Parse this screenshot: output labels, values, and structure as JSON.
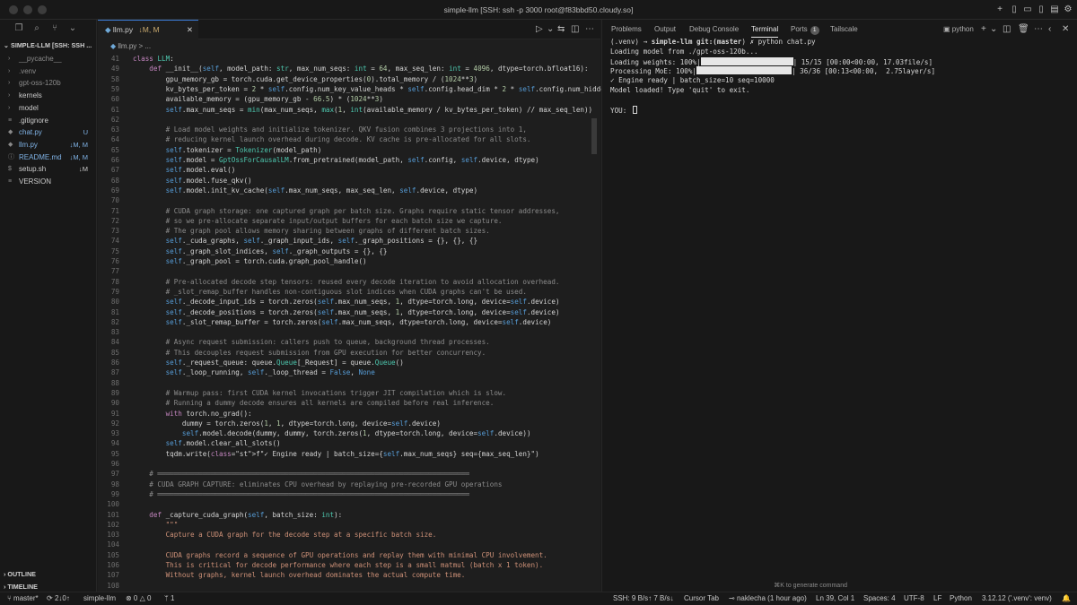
{
  "window": {
    "title": "simple-llm [SSH: ssh -p 3000 root@f83bbd50.cloudy.so]"
  },
  "explorer": {
    "root": "SIMPLE-LLM [SSH: SSH ...",
    "items": [
      {
        "name": "__pycache__",
        "kind": "folder",
        "badge": "",
        "color": "#8a8a8a"
      },
      {
        "name": ".venv",
        "kind": "folder",
        "badge": "",
        "color": "#8a8a8a"
      },
      {
        "name": "gpt-oss-120b",
        "kind": "folder",
        "badge": "",
        "color": "#8a8a8a"
      },
      {
        "name": "kernels",
        "kind": "folder",
        "badge": "",
        "color": "#cccccc"
      },
      {
        "name": "model",
        "kind": "folder",
        "badge": "",
        "color": "#cccccc"
      },
      {
        "name": ".gitignore",
        "kind": "file",
        "badge": "",
        "color": "#cccccc"
      },
      {
        "name": "chat.py",
        "kind": "file",
        "badge": "U",
        "color": "#7fb2e5"
      },
      {
        "name": "llm.py",
        "kind": "file",
        "badge": "↓M, M",
        "color": "#7fb2e5"
      },
      {
        "name": "README.md",
        "kind": "file",
        "badge": "↓M, M",
        "color": "#7fb2e5"
      },
      {
        "name": "setup.sh",
        "kind": "file",
        "badge": "↓M",
        "color": "#cccccc"
      },
      {
        "name": "VERSION",
        "kind": "file",
        "badge": "",
        "color": "#cccccc"
      }
    ],
    "outline": "OUTLINE",
    "timeline": "TIMELINE"
  },
  "editor": {
    "tab_label": "llm.py",
    "tab_status": "↓M, M",
    "close_glyph": "✕",
    "breadcrumb_file": "llm.py",
    "breadcrumb_sep": " > ...",
    "lines": [
      {
        "n": "41",
        "t": "class LLM:"
      },
      {
        "n": "49",
        "t": "    def __init__(self, model_path: str, max_num_seqs: int = 64, max_seq_len: int = 4096, dtype=torch.bfloat16):"
      },
      {
        "n": "58",
        "t": "        gpu_memory_gb = torch.cuda.get_device_properties(0).total_memory / (1024**3)"
      },
      {
        "n": "59",
        "t": "        kv_bytes_per_token = 2 * self.config.num_key_value_heads * self.config.head_dim * 2 * self.config.num_hidde"
      },
      {
        "n": "60",
        "t": "        available_memory = (gpu_memory_gb - 66.5) * (1024**3)"
      },
      {
        "n": "61",
        "t": "        self.max_num_seqs = min(max_num_seqs, max(1, int(available_memory / kv_bytes_per_token) // max_seq_len))"
      },
      {
        "n": "62",
        "t": ""
      },
      {
        "n": "63",
        "t": "        # Load model weights and initialize tokenizer. QKV fusion combines 3 projections into 1,"
      },
      {
        "n": "64",
        "t": "        # reducing kernel launch overhead during decode. KV cache is pre-allocated for all slots."
      },
      {
        "n": "65",
        "t": "        self.tokenizer = Tokenizer(model_path)"
      },
      {
        "n": "66",
        "t": "        self.model = GptOssForCausalLM.from_pretrained(model_path, self.config, self.device, dtype)"
      },
      {
        "n": "67",
        "t": "        self.model.eval()"
      },
      {
        "n": "68",
        "t": "        self.model.fuse_qkv()"
      },
      {
        "n": "69",
        "t": "        self.model.init_kv_cache(self.max_num_seqs, max_seq_len, self.device, dtype)"
      },
      {
        "n": "70",
        "t": ""
      },
      {
        "n": "71",
        "t": "        # CUDA graph storage: one captured graph per batch size. Graphs require static tensor addresses,"
      },
      {
        "n": "72",
        "t": "        # so we pre-allocate separate input/output buffers for each batch size we capture."
      },
      {
        "n": "73",
        "t": "        # The graph pool allows memory sharing between graphs of different batch sizes."
      },
      {
        "n": "74",
        "t": "        self._cuda_graphs, self._graph_input_ids, self._graph_positions = {}, {}, {}"
      },
      {
        "n": "75",
        "t": "        self._graph_slot_indices, self._graph_outputs = {}, {}"
      },
      {
        "n": "76",
        "t": "        self._graph_pool = torch.cuda.graph_pool_handle()"
      },
      {
        "n": "77",
        "t": ""
      },
      {
        "n": "78",
        "t": "        # Pre-allocated decode step tensors: reused every decode iteration to avoid allocation overhead."
      },
      {
        "n": "79",
        "t": "        # _slot_remap_buffer handles non-contiguous slot indices when CUDA graphs can't be used."
      },
      {
        "n": "80",
        "t": "        self._decode_input_ids = torch.zeros(self.max_num_seqs, 1, dtype=torch.long, device=self.device)"
      },
      {
        "n": "81",
        "t": "        self._decode_positions = torch.zeros(self.max_num_seqs, 1, dtype=torch.long, device=self.device)"
      },
      {
        "n": "82",
        "t": "        self._slot_remap_buffer = torch.zeros(self.max_num_seqs, dtype=torch.long, device=self.device)"
      },
      {
        "n": "83",
        "t": ""
      },
      {
        "n": "84",
        "t": "        # Async request submission: callers push to queue, background thread processes."
      },
      {
        "n": "85",
        "t": "        # This decouples request submission from GPU execution for better concurrency."
      },
      {
        "n": "86",
        "t": "        self._request_queue: queue.Queue[_Request] = queue.Queue()"
      },
      {
        "n": "87",
        "t": "        self._loop_running, self._loop_thread = False, None"
      },
      {
        "n": "88",
        "t": ""
      },
      {
        "n": "89",
        "t": "        # Warmup pass: first CUDA kernel invocations trigger JIT compilation which is slow."
      },
      {
        "n": "90",
        "t": "        # Running a dummy decode ensures all kernels are compiled before real inference."
      },
      {
        "n": "91",
        "t": "        with torch.no_grad():"
      },
      {
        "n": "92",
        "t": "            dummy = torch.zeros(1, 1, dtype=torch.long, device=self.device)"
      },
      {
        "n": "93",
        "t": "            self.model.decode(dummy, dummy, torch.zeros(1, dtype=torch.long, device=self.device))"
      },
      {
        "n": "94",
        "t": "        self.model.clear_all_slots()"
      },
      {
        "n": "95",
        "t": "        tqdm.write(f\"✓ Engine ready | batch_size={self.max_num_seqs} seq={max_seq_len}\")"
      },
      {
        "n": "96",
        "t": ""
      },
      {
        "n": "97",
        "t": "    # ════════════════════════════════════════════════════════════════════════════"
      },
      {
        "n": "98",
        "t": "    # CUDA GRAPH CAPTURE: eliminates CPU overhead by replaying pre-recorded GPU operations"
      },
      {
        "n": "99",
        "t": "    # ════════════════════════════════════════════════════════════════════════════"
      },
      {
        "n": "100",
        "t": ""
      },
      {
        "n": "101",
        "t": "    def _capture_cuda_graph(self, batch_size: int):"
      },
      {
        "n": "102",
        "t": "        \"\"\""
      },
      {
        "n": "103",
        "t": "        Capture a CUDA graph for the decode step at a specific batch size."
      },
      {
        "n": "104",
        "t": ""
      },
      {
        "n": "105",
        "t": "        CUDA graphs record a sequence of GPU operations and replay them with minimal CPU involvement."
      },
      {
        "n": "106",
        "t": "        This is critical for decode performance where each step is a small matmul (batch x 1 token)."
      },
      {
        "n": "107",
        "t": "        Without graphs, kernel launch overhead dominates the actual compute time."
      },
      {
        "n": "108",
        "t": ""
      }
    ]
  },
  "panel": {
    "tabs": [
      "Problems",
      "Output",
      "Debug Console",
      "Terminal",
      "Ports",
      "Tailscale"
    ],
    "active_tab": "Terminal",
    "ports_count": "1",
    "shell": "python",
    "terminal_lines": [
      {
        "pre": "(.venv) → ",
        "bold": "simple-llm",
        "mid": " git:(",
        "branch": "master",
        "post": ") ✗ python chat.py"
      },
      {
        "text": "Loading model from ./gpt-oss-120b..."
      },
      {
        "bar_pre": "Loading weights: 100%|",
        "bar_post": "| 15/15 [00:00<00:00, 17.03file/s]"
      },
      {
        "bar_pre": "Processing MoE: 100%|",
        "bar_post": "| 36/36 [00:13<00:00,  2.75layer/s]"
      },
      {
        "text": "✓ Engine ready | batch_size=10 seq=10000"
      },
      {
        "text": "Model loaded! Type 'quit' to exit."
      },
      {
        "text": ""
      },
      {
        "text": "YOU: "
      }
    ],
    "hint": "⌘K to generate command"
  },
  "statusbar": {
    "branch": "master*",
    "sync": "2↓0↑",
    "project": "simple-llm",
    "errors": "⊗ 0 △ 0",
    "ports": "1",
    "ssh": "SSH: 9 B/s↑ 7 B/s↓",
    "cursor_tab": "Cursor Tab",
    "blame": "naklecha (1 hour ago)",
    "position": "Ln 39, Col 1",
    "spaces": "Spaces: 4",
    "encoding": "UTF-8",
    "eol": "LF",
    "language": "Python",
    "interpreter": "3.12.12 ('.venv': venv)"
  }
}
